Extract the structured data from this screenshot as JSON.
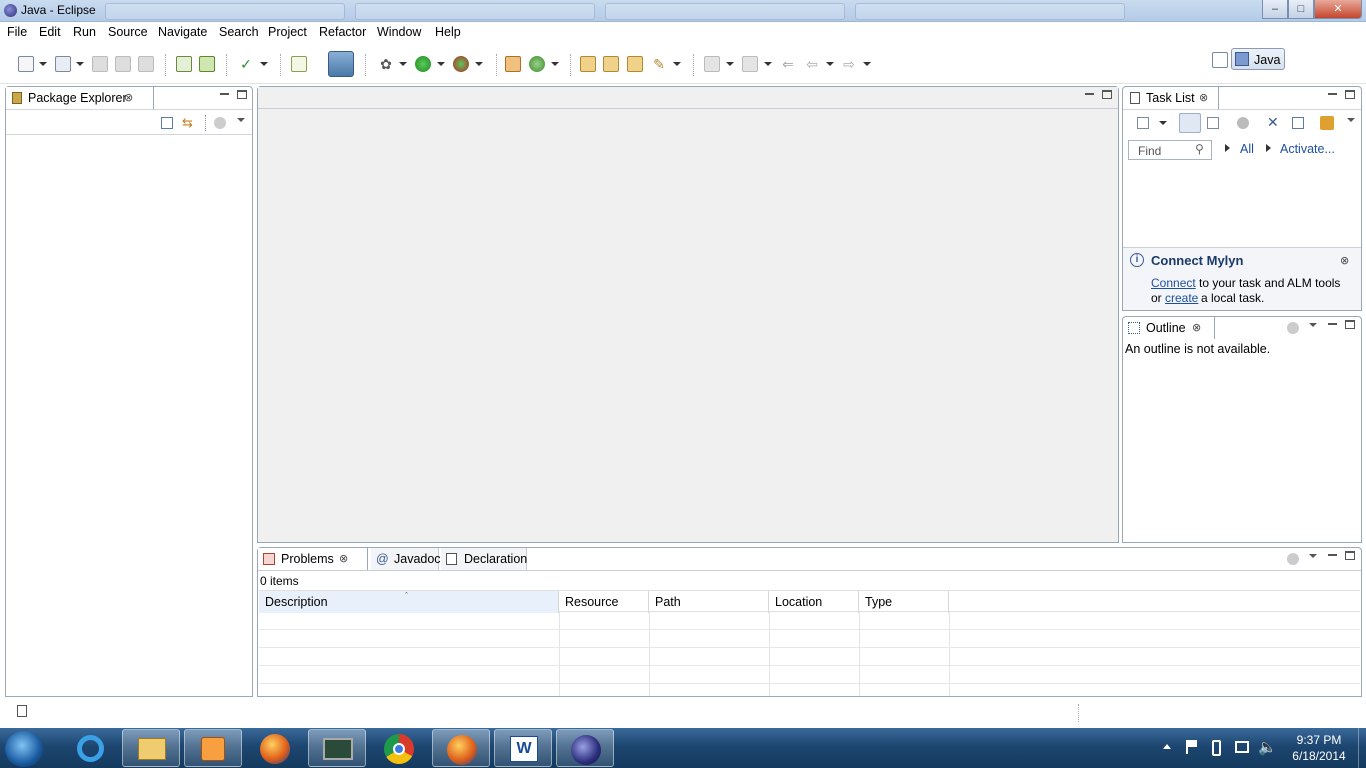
{
  "window": {
    "title": "Java - Eclipse"
  },
  "menu": [
    "File",
    "Edit",
    "Run",
    "Source",
    "Navigate",
    "Search",
    "Project",
    "Refactor",
    "Window",
    "Help"
  ],
  "perspective": {
    "label": "Java"
  },
  "package_explorer": {
    "title": "Package Explorer"
  },
  "task_list": {
    "title": "Task List",
    "find_placeholder": "Find",
    "all_label": "All",
    "activate_label": "Activate..."
  },
  "mylyn": {
    "title": "Connect Mylyn",
    "connect_link": "Connect",
    "text1": "to your task and ALM tools",
    "or": "or",
    "create_link": "create",
    "text2": "a local task."
  },
  "outline": {
    "title": "Outline",
    "message": "An outline is not available."
  },
  "bottom": {
    "tabs": [
      "Problems",
      "Javadoc",
      "Declaration"
    ],
    "count": "0 items",
    "columns": [
      "Description",
      "Resource",
      "Path",
      "Location",
      "Type"
    ]
  },
  "clock": {
    "time": "9:37 PM",
    "date": "6/18/2014"
  },
  "icons": {
    "window": [
      "eclipse-icon",
      "minimize-icon",
      "maximize-icon",
      "close-icon"
    ],
    "taskbar": [
      "start-orb-icon",
      "internet-explorer-icon",
      "file-explorer-icon",
      "media-player-icon",
      "firefox-icon",
      "system-monitor-icon",
      "chrome-icon",
      "firefox-icon",
      "word-icon",
      "eclipse-icon"
    ]
  },
  "colors": {
    "accent": "#1f4fa0",
    "taskbar": "#1d4670"
  }
}
